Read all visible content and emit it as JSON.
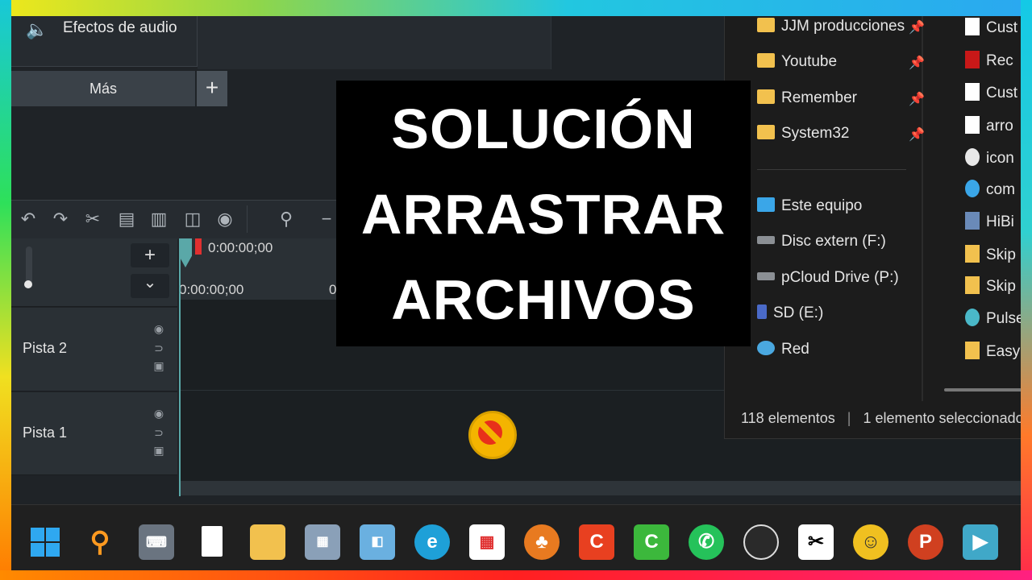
{
  "editor": {
    "effects_label": "Efectos de audio",
    "mas_tab": "Más",
    "plus_tab": "+",
    "timecode_playhead": "0:00:00;00",
    "timecode_ruler": "0:00:00;00",
    "ruler_partial": "0",
    "tracks": [
      {
        "name": "Pista 2"
      },
      {
        "name": "Pista 1"
      }
    ],
    "add_track": "+",
    "collapse": "⌄"
  },
  "title_card": {
    "lines": [
      "SOLUCIÓN",
      "ARRASTRAR",
      "ARCHIVOS"
    ]
  },
  "explorer": {
    "quick_access": [
      {
        "label": "JJM producciones",
        "pinned": true
      },
      {
        "label": "Youtube",
        "pinned": true
      },
      {
        "label": "Remember",
        "pinned": true
      },
      {
        "label": "System32",
        "pinned": true
      }
    ],
    "locations": [
      {
        "label": "Este equipo",
        "icon": "computer-icon"
      },
      {
        "label": "Disc extern (F:)",
        "icon": "drive-icon"
      },
      {
        "label": "pCloud Drive (P:)",
        "icon": "drive-icon"
      },
      {
        "label": "SD (E:)",
        "icon": "sd-icon"
      },
      {
        "label": "Red",
        "icon": "network-icon"
      }
    ],
    "files": [
      "Cust",
      "Rec",
      "Cust",
      "arro",
      "icon",
      "com",
      "HiBi",
      "Skip",
      "Skip",
      "Pulse",
      "Easy"
    ],
    "status_count": "118 elementos",
    "status_selected": "1 elemento seleccionado"
  },
  "taskbar": {
    "icons": [
      "windows-start-icon",
      "search-icon",
      "keyboard-app-icon",
      "notepad-icon",
      "file-explorer-icon",
      "app-icon",
      "app-icon",
      "edge-icon",
      "store-icon",
      "fl-studio-icon",
      "camtasia-icon",
      "camtasia-green-icon",
      "whatsapp-icon",
      "obs-icon",
      "capcut-icon",
      "emoji-app-icon",
      "powerpoint-icon",
      "video-app-icon"
    ]
  }
}
